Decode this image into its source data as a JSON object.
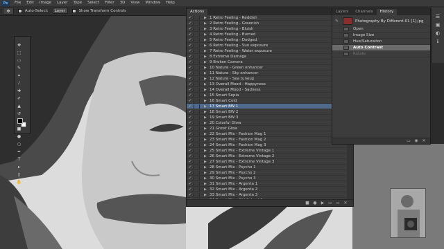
{
  "app": {
    "logo": "Ps"
  },
  "menubar": [
    "File",
    "Edit",
    "Image",
    "Layer",
    "Type",
    "Select",
    "Filter",
    "3D",
    "View",
    "Window",
    "Help"
  ],
  "options": {
    "auto_select_label": "Auto-Select:",
    "auto_select_value": "Layer",
    "transform_label": "Show Transform Controls"
  },
  "actions_panel": {
    "tab_label": "Actions",
    "items": [
      "1 Retro Feeling - Reddish",
      "2 Retro Feeling - Greenish",
      "3 Retro Feeling - Bluish",
      "4 Retro Feeling - Burned",
      "5 Retro Feeling - Dodged",
      "6 Retro Feeling - Sun exposure",
      "7 Retro Feeling - Water exposure",
      "8 Extreme Damage",
      "9 Broken Camera",
      "10 Nature - Green enhancer",
      "11 Nature - Sky enhancer",
      "12 Nature - Sea tuneup",
      "13 Overall Mood - Happyness",
      "14 Overall Mood - Sadness",
      "15 Smart Sepia",
      "16 Smart Cold",
      "17 Smart BW 1",
      "18 Smart BW 2",
      "19 Smart BW 3",
      "20 Colorful Glow",
      "21 Ghost Glow",
      "22 Smart Mix - Fashion Mag 1",
      "23 Smart Mix - Fashion Mag 2",
      "24 Smart Mix - Fashion Mag 3",
      "25 Smart Mix - Extreme Vintage 1",
      "26 Smart Mix - Extreme Vintage 2",
      "27 Smart Mix - Extreme Vintage 3",
      "28 Smart Mix - Psycho 1",
      "29 Smart Mix - Psycho 2",
      "30 Smart Mix - Psycho 3",
      "31 Smart Mix - Argenta 1",
      "32 Smart Mix - Argenta 2",
      "33 Smart Mix - Argenta 3",
      "34 Smart Mix - Old School 1"
    ],
    "selected_index": 16
  },
  "history_panel": {
    "tabs": [
      "Layers",
      "Channels",
      "History"
    ],
    "active_tab": "History",
    "snapshot_name": "Photography By Different-01 [1].jpg",
    "steps": [
      {
        "name": "Open",
        "state": "normal"
      },
      {
        "name": "Image Size",
        "state": "normal"
      },
      {
        "name": "Hue/Saturation",
        "state": "normal"
      },
      {
        "name": "Auto Contrast",
        "state": "current"
      },
      {
        "name": "Rotate",
        "state": "disabled"
      }
    ]
  },
  "colors": {
    "foreground": "#000000",
    "background": "#ffffff",
    "selection": "#4f6a8a"
  }
}
